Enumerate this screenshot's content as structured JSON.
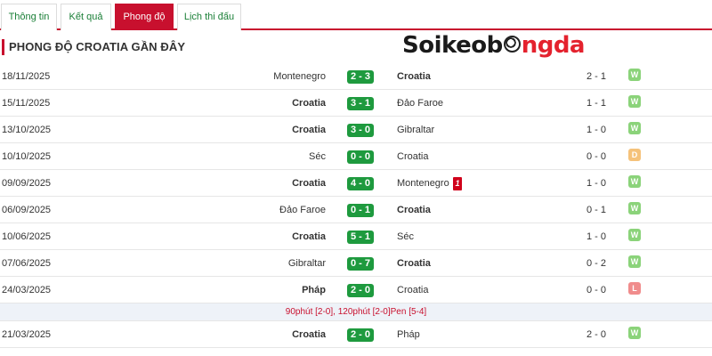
{
  "tabs": [
    {
      "label": "Thông tin",
      "active": false
    },
    {
      "label": "Kết quả",
      "active": false
    },
    {
      "label": "Phong độ",
      "active": true
    },
    {
      "label": "Lịch thi đấu",
      "active": false
    }
  ],
  "section_title": "PHONG ĐỘ CROATIA GẦN ĐÂY",
  "logo": {
    "part1": "Soikeob",
    "part2": "ngda"
  },
  "colors": {
    "accent": "#c8102e",
    "score_bg": "#1e9a3e",
    "win": "#8bd37a",
    "draw": "#f5c27a",
    "loss": "#f08c8c",
    "red_card": "#d0021b"
  },
  "matches": [
    {
      "date": "18/11/2025",
      "home": "Montenegro",
      "home_bold": false,
      "score": "2 - 3",
      "away": "Croatia",
      "away_bold": true,
      "away_red_card": "",
      "ht": "2 - 1",
      "result": "W"
    },
    {
      "date": "15/11/2025",
      "home": "Croatia",
      "home_bold": true,
      "score": "3 - 1",
      "away": "Đảo Faroe",
      "away_bold": false,
      "away_red_card": "",
      "ht": "1 - 1",
      "result": "W"
    },
    {
      "date": "13/10/2025",
      "home": "Croatia",
      "home_bold": true,
      "score": "3 - 0",
      "away": "Gibraltar",
      "away_bold": false,
      "away_red_card": "",
      "ht": "1 - 0",
      "result": "W"
    },
    {
      "date": "10/10/2025",
      "home": "Séc",
      "home_bold": false,
      "score": "0 - 0",
      "away": "Croatia",
      "away_bold": false,
      "away_red_card": "",
      "ht": "0 - 0",
      "result": "D"
    },
    {
      "date": "09/09/2025",
      "home": "Croatia",
      "home_bold": true,
      "score": "4 - 0",
      "away": "Montenegro",
      "away_bold": false,
      "away_red_card": "1",
      "ht": "1 - 0",
      "result": "W"
    },
    {
      "date": "06/09/2025",
      "home": "Đảo Faroe",
      "home_bold": false,
      "score": "0 - 1",
      "away": "Croatia",
      "away_bold": true,
      "away_red_card": "",
      "ht": "0 - 1",
      "result": "W"
    },
    {
      "date": "10/06/2025",
      "home": "Croatia",
      "home_bold": true,
      "score": "5 - 1",
      "away": "Séc",
      "away_bold": false,
      "away_red_card": "",
      "ht": "1 - 0",
      "result": "W"
    },
    {
      "date": "07/06/2025",
      "home": "Gibraltar",
      "home_bold": false,
      "score": "0 - 7",
      "away": "Croatia",
      "away_bold": true,
      "away_red_card": "",
      "ht": "0 - 2",
      "result": "W"
    },
    {
      "date": "24/03/2025",
      "home": "Pháp",
      "home_bold": true,
      "score": "2 - 0",
      "away": "Croatia",
      "away_bold": false,
      "away_red_card": "",
      "ht": "0 - 0",
      "result": "L"
    },
    {
      "note": "90phút [2-0], 120phút [2-0]Pen [5-4]"
    },
    {
      "date": "21/03/2025",
      "home": "Croatia",
      "home_bold": true,
      "score": "2 - 0",
      "away": "Pháp",
      "away_bold": false,
      "away_red_card": "",
      "ht": "2 - 0",
      "result": "W"
    }
  ]
}
